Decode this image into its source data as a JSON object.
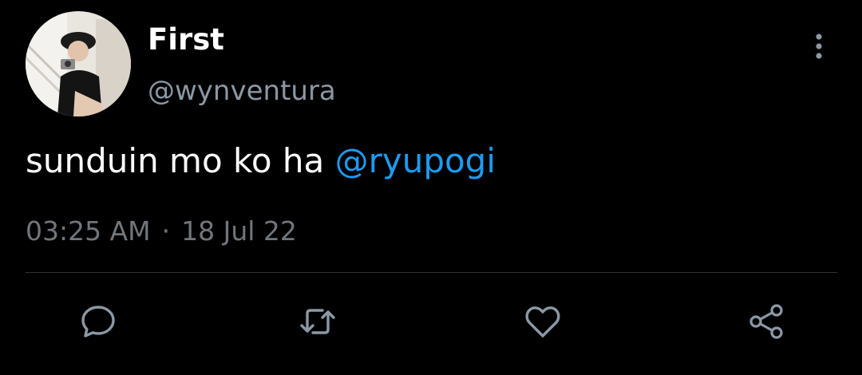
{
  "tweet": {
    "display_name": "First",
    "handle": "@wynventura",
    "text": "sunduin mo ko ha ",
    "mention": "@ryupogi",
    "time": "03:25 AM",
    "separator": "·",
    "date": "18 Jul 22"
  },
  "icons": {
    "more": "more-vertical-icon",
    "reply": "reply-bubble-icon",
    "retweet": "retweet-icon",
    "like": "heart-icon",
    "share": "share-icon"
  },
  "colors": {
    "background": "#000000",
    "mention": "#1d9bf0",
    "secondary_text": "#71767b",
    "icon": "#8b98a5"
  }
}
